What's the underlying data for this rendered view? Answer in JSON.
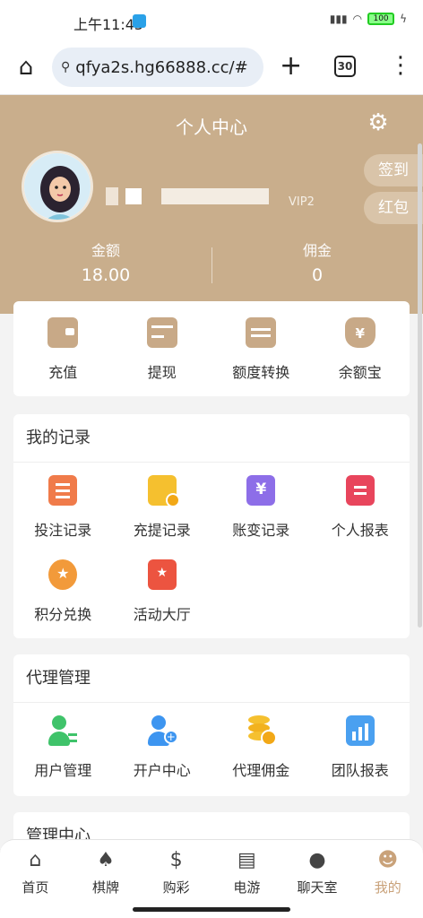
{
  "statusbar": {
    "time": "上午11:45",
    "battery": "100"
  },
  "browser": {
    "url": "qfya2s.hg66888.cc/#",
    "tab_count": "30"
  },
  "header": {
    "title": "个人中心",
    "vip": "VIP2",
    "checkin": "签到",
    "redpacket": "红包",
    "stats": [
      {
        "label": "金额",
        "value": "18.00"
      },
      {
        "label": "佣金",
        "value": "0"
      }
    ]
  },
  "quick": [
    {
      "label": "充值",
      "icon": "wallet-icon"
    },
    {
      "label": "提现",
      "icon": "card-icon"
    },
    {
      "label": "额度转换",
      "icon": "transfer-icon"
    },
    {
      "label": "余额宝",
      "icon": "money-bag-icon"
    }
  ],
  "records": {
    "title": "我的记录",
    "items": [
      {
        "label": "投注记录",
        "icon": "bet-record-icon",
        "color": "#f07b4a"
      },
      {
        "label": "充提记录",
        "icon": "deposit-record-icon",
        "color": "#f5c02f"
      },
      {
        "label": "账变记录",
        "icon": "yen-record-icon",
        "color": "#8d6ee8"
      },
      {
        "label": "个人报表",
        "icon": "report-icon",
        "color": "#e8455c"
      },
      {
        "label": "积分兑换",
        "icon": "medal-icon",
        "color": "#f29a3a"
      },
      {
        "label": "活动大厅",
        "icon": "gift-icon",
        "color": "#ec5440"
      }
    ]
  },
  "agent": {
    "title": "代理管理",
    "items": [
      {
        "label": "用户管理",
        "icon": "user-manage-icon",
        "color": "#3fc36a"
      },
      {
        "label": "开户中心",
        "icon": "add-user-icon",
        "color": "#3d95f0"
      },
      {
        "label": "代理佣金",
        "icon": "coins-icon",
        "color": "#f5c02f"
      },
      {
        "label": "团队报表",
        "icon": "team-report-icon",
        "color": "#4aa0f0"
      }
    ]
  },
  "mgmt": {
    "title": "管理中心"
  },
  "nav": [
    {
      "label": "首页",
      "icon": "home-icon"
    },
    {
      "label": "棋牌",
      "icon": "cards-icon"
    },
    {
      "label": "购彩",
      "icon": "cart-icon"
    },
    {
      "label": "电游",
      "icon": "slot-icon"
    },
    {
      "label": "聊天室",
      "icon": "chat-icon"
    },
    {
      "label": "我的",
      "icon": "profile-icon"
    }
  ]
}
